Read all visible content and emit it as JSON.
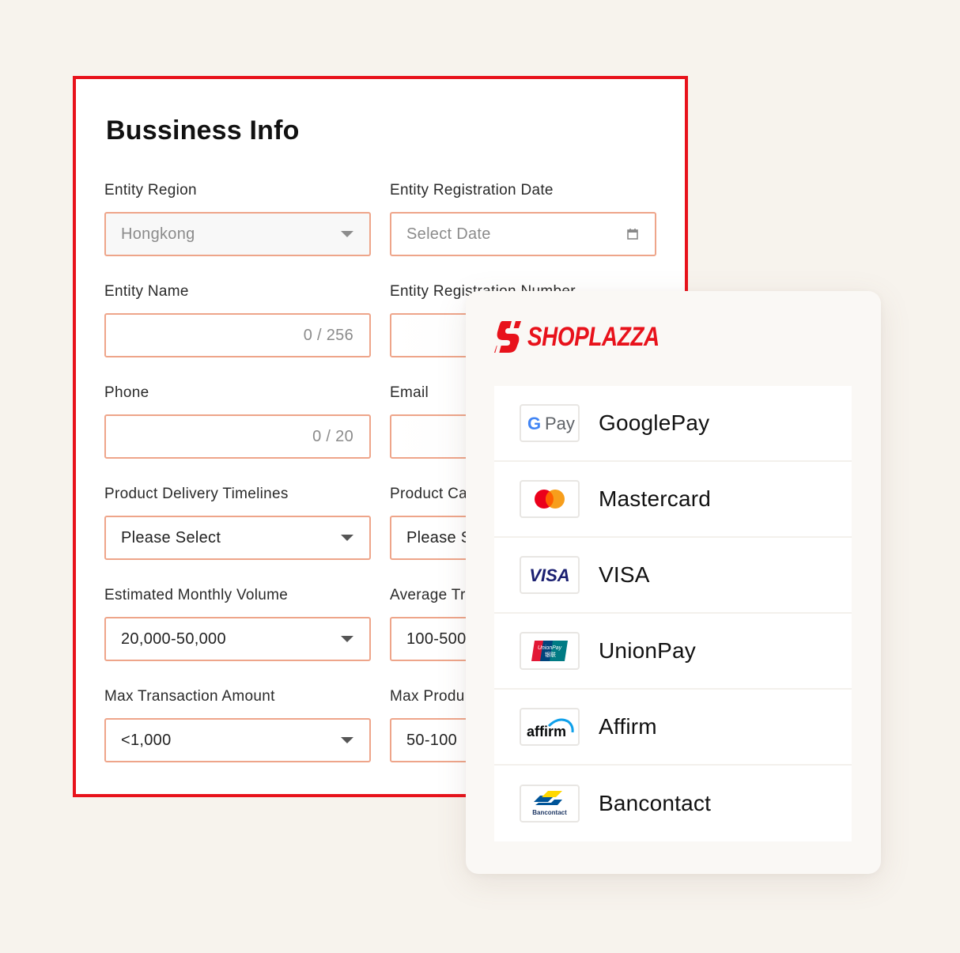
{
  "form": {
    "title": "Bussiness Info",
    "fields": {
      "entity_region": {
        "label": "Entity Region",
        "value": "Hongkong"
      },
      "entity_registration_date": {
        "label": "Entity Registration Date",
        "placeholder": "Select Date"
      },
      "entity_name": {
        "label": "Entity Name",
        "counter": "0 / 256"
      },
      "entity_registration_number": {
        "label": "Entity Registration Number"
      },
      "phone": {
        "label": "Phone",
        "counter": "0 / 20"
      },
      "email": {
        "label": "Email"
      },
      "product_delivery_timelines": {
        "label": "Product Delivery Timelines",
        "value": "Please Select"
      },
      "product_category": {
        "label": "Product Ca",
        "value": "Please S"
      },
      "estimated_monthly_volume": {
        "label": "Estimated Monthly Volume",
        "value": "20,000-50,000"
      },
      "average_transaction": {
        "label": "Average Tr",
        "value": "100-500"
      },
      "max_transaction_amount": {
        "label": "Max Transaction Amount",
        "value": "<1,000"
      },
      "max_product": {
        "label": "Max Produ",
        "value": "50-100"
      }
    }
  },
  "payments": {
    "brand": "SHOPLAZZA",
    "brand_color": "#e8121b",
    "methods": [
      {
        "name": "GooglePay",
        "icon": "google-pay-logo"
      },
      {
        "name": "Mastercard",
        "icon": "mastercard-logo"
      },
      {
        "name": "VISA",
        "icon": "visa-logo"
      },
      {
        "name": "UnionPay",
        "icon": "unionpay-logo"
      },
      {
        "name": "Affirm",
        "icon": "affirm-logo"
      },
      {
        "name": "Bancontact",
        "icon": "bancontact-logo"
      }
    ],
    "logo_text": {
      "gpay_g": "G",
      "gpay_pay": "Pay",
      "visa": "VISA",
      "unionpay_1": "UnionPay",
      "unionpay_2": "银联",
      "affirm": "affirm",
      "bancontact": "Bancontact"
    }
  }
}
